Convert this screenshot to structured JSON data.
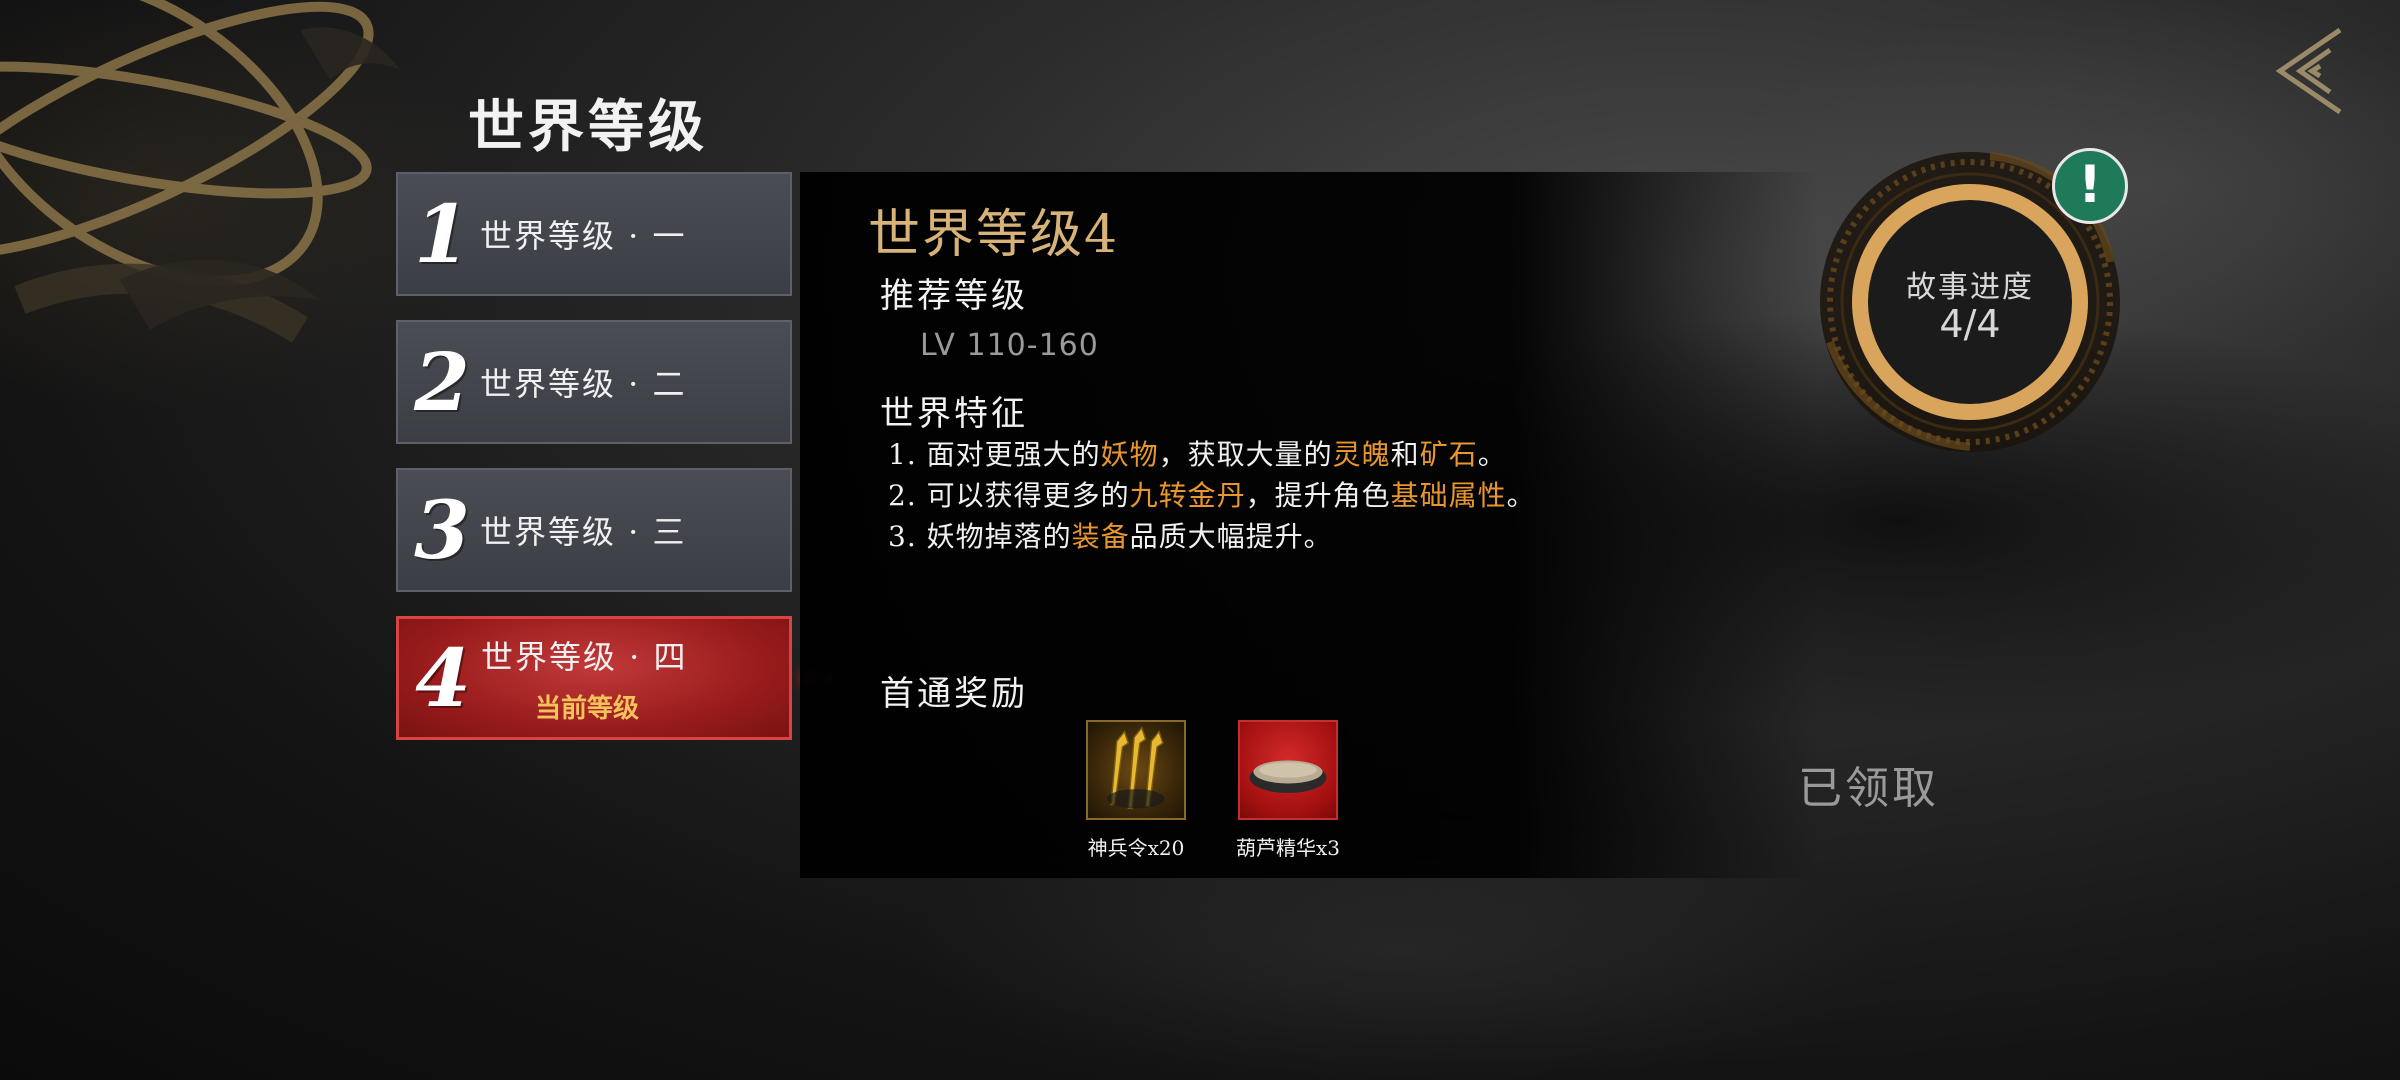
{
  "page_title": "世界等级",
  "levels": [
    {
      "num": "1",
      "label": "世界等级 · 一",
      "current": ""
    },
    {
      "num": "2",
      "label": "世界等级 · 二",
      "current": ""
    },
    {
      "num": "3",
      "label": "世界等级 · 三",
      "current": ""
    },
    {
      "num": "4",
      "label": "世界等级 · 四",
      "current": "当前等级"
    }
  ],
  "detail": {
    "title": "世界等级4",
    "recommended_heading": "推荐等级",
    "recommended_value": "LV 110-160",
    "features_heading": "世界特征",
    "features": [
      {
        "a": "1. 面对更强大的",
        "h1": "妖物",
        "b": "，获取大量的",
        "h2": "灵魄",
        "c": "和",
        "h3": "矿石",
        "d": "。"
      },
      {
        "a": "2. 可以获得更多的",
        "h1": "九转金丹",
        "b": "，提升角色",
        "h2": "基础属性",
        "c": "。",
        "h3": "",
        "d": ""
      },
      {
        "a": "3. 妖物掉落的",
        "h1": "装备",
        "b": "品质大幅提升。",
        "h2": "",
        "c": "",
        "h3": "",
        "d": ""
      }
    ],
    "reward_heading": "首通奖励",
    "rewards": [
      {
        "label": "神兵令x20"
      },
      {
        "label": "葫芦精华x3"
      }
    ],
    "claimed_text": "已领取"
  },
  "story": {
    "label": "故事进度",
    "value": "4/4",
    "alert": "!"
  },
  "colors": {
    "highlight": "#e8962e",
    "title_gold": "#d8b377",
    "active_red": "#b02222",
    "ring_gold": "#d9a45c",
    "alert_green": "#1f7a5a"
  },
  "icons": {
    "back": "back-arrow-icon",
    "reward_1": "weapon-token-icon",
    "reward_2": "gourd-essence-icon"
  }
}
